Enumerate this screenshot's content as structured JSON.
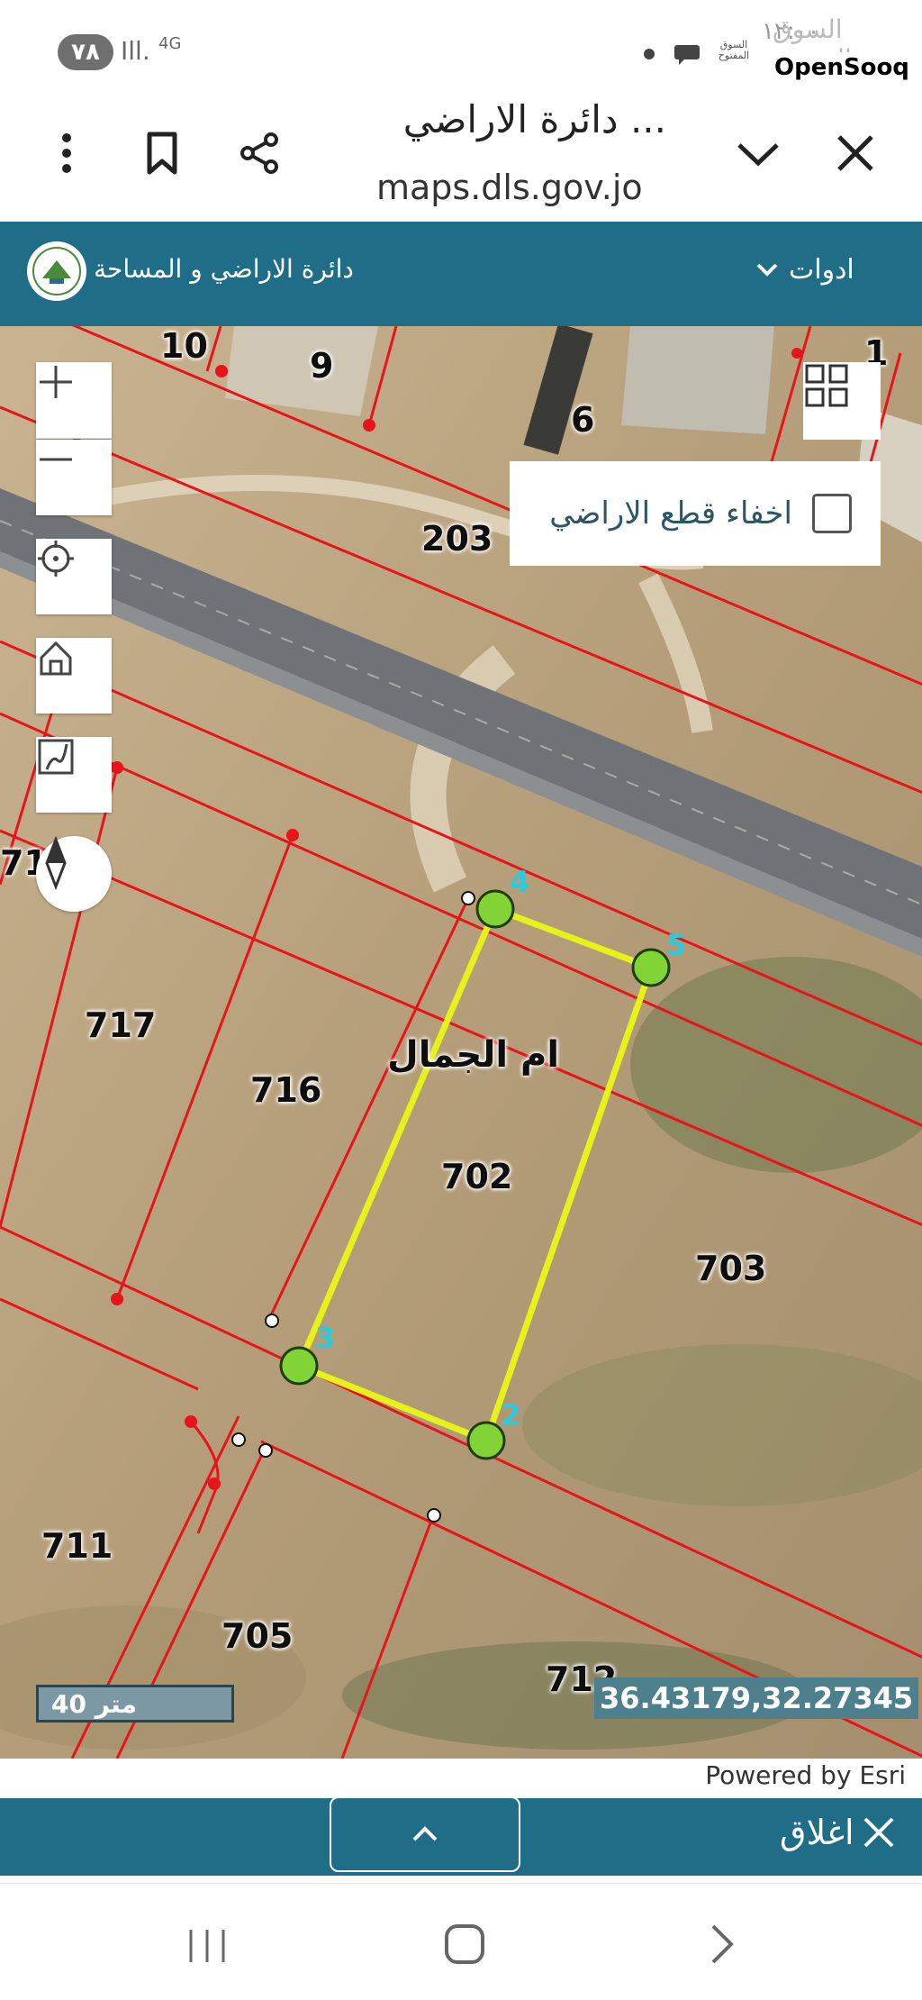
{
  "status_bar": {
    "battery": "٧٨",
    "signal": "Ill.",
    "network": "4G",
    "clock": "١٢:٠٠",
    "watermark_ar": "السوق المفتوح",
    "sooq_badge": "السوق المفتوح",
    "opensooq": "OpenSooq"
  },
  "browser": {
    "title": "دائرة الاراضي ...",
    "url": "maps.dls.gov.jo",
    "icons": [
      "more-vert-icon",
      "bookmark-icon",
      "share-icon",
      "chevron-down-icon",
      "close-icon"
    ]
  },
  "app_header": {
    "title": "دائرة الاراضي و المساحة",
    "tools_label": "ادوات"
  },
  "map": {
    "hide_parcels_label": "اخفاء قطع الاراضي",
    "hide_parcels_checked": false,
    "village_name": "ام الجمال",
    "parcels": [
      "10",
      "9",
      "6",
      "1",
      "203",
      "71",
      "717",
      "716",
      "702",
      "703",
      "711",
      "705",
      "712"
    ],
    "vertex_labels": [
      "4",
      "5",
      "3",
      "2"
    ],
    "scale_label": "40 متر",
    "coordinates": "36.43179,32.27345",
    "attribution": "Powered by Esri",
    "highlight_color": "#e7f21a",
    "parcel_line_color": "#e8141b"
  },
  "bottom_panel": {
    "close_label": "اغلاق"
  }
}
